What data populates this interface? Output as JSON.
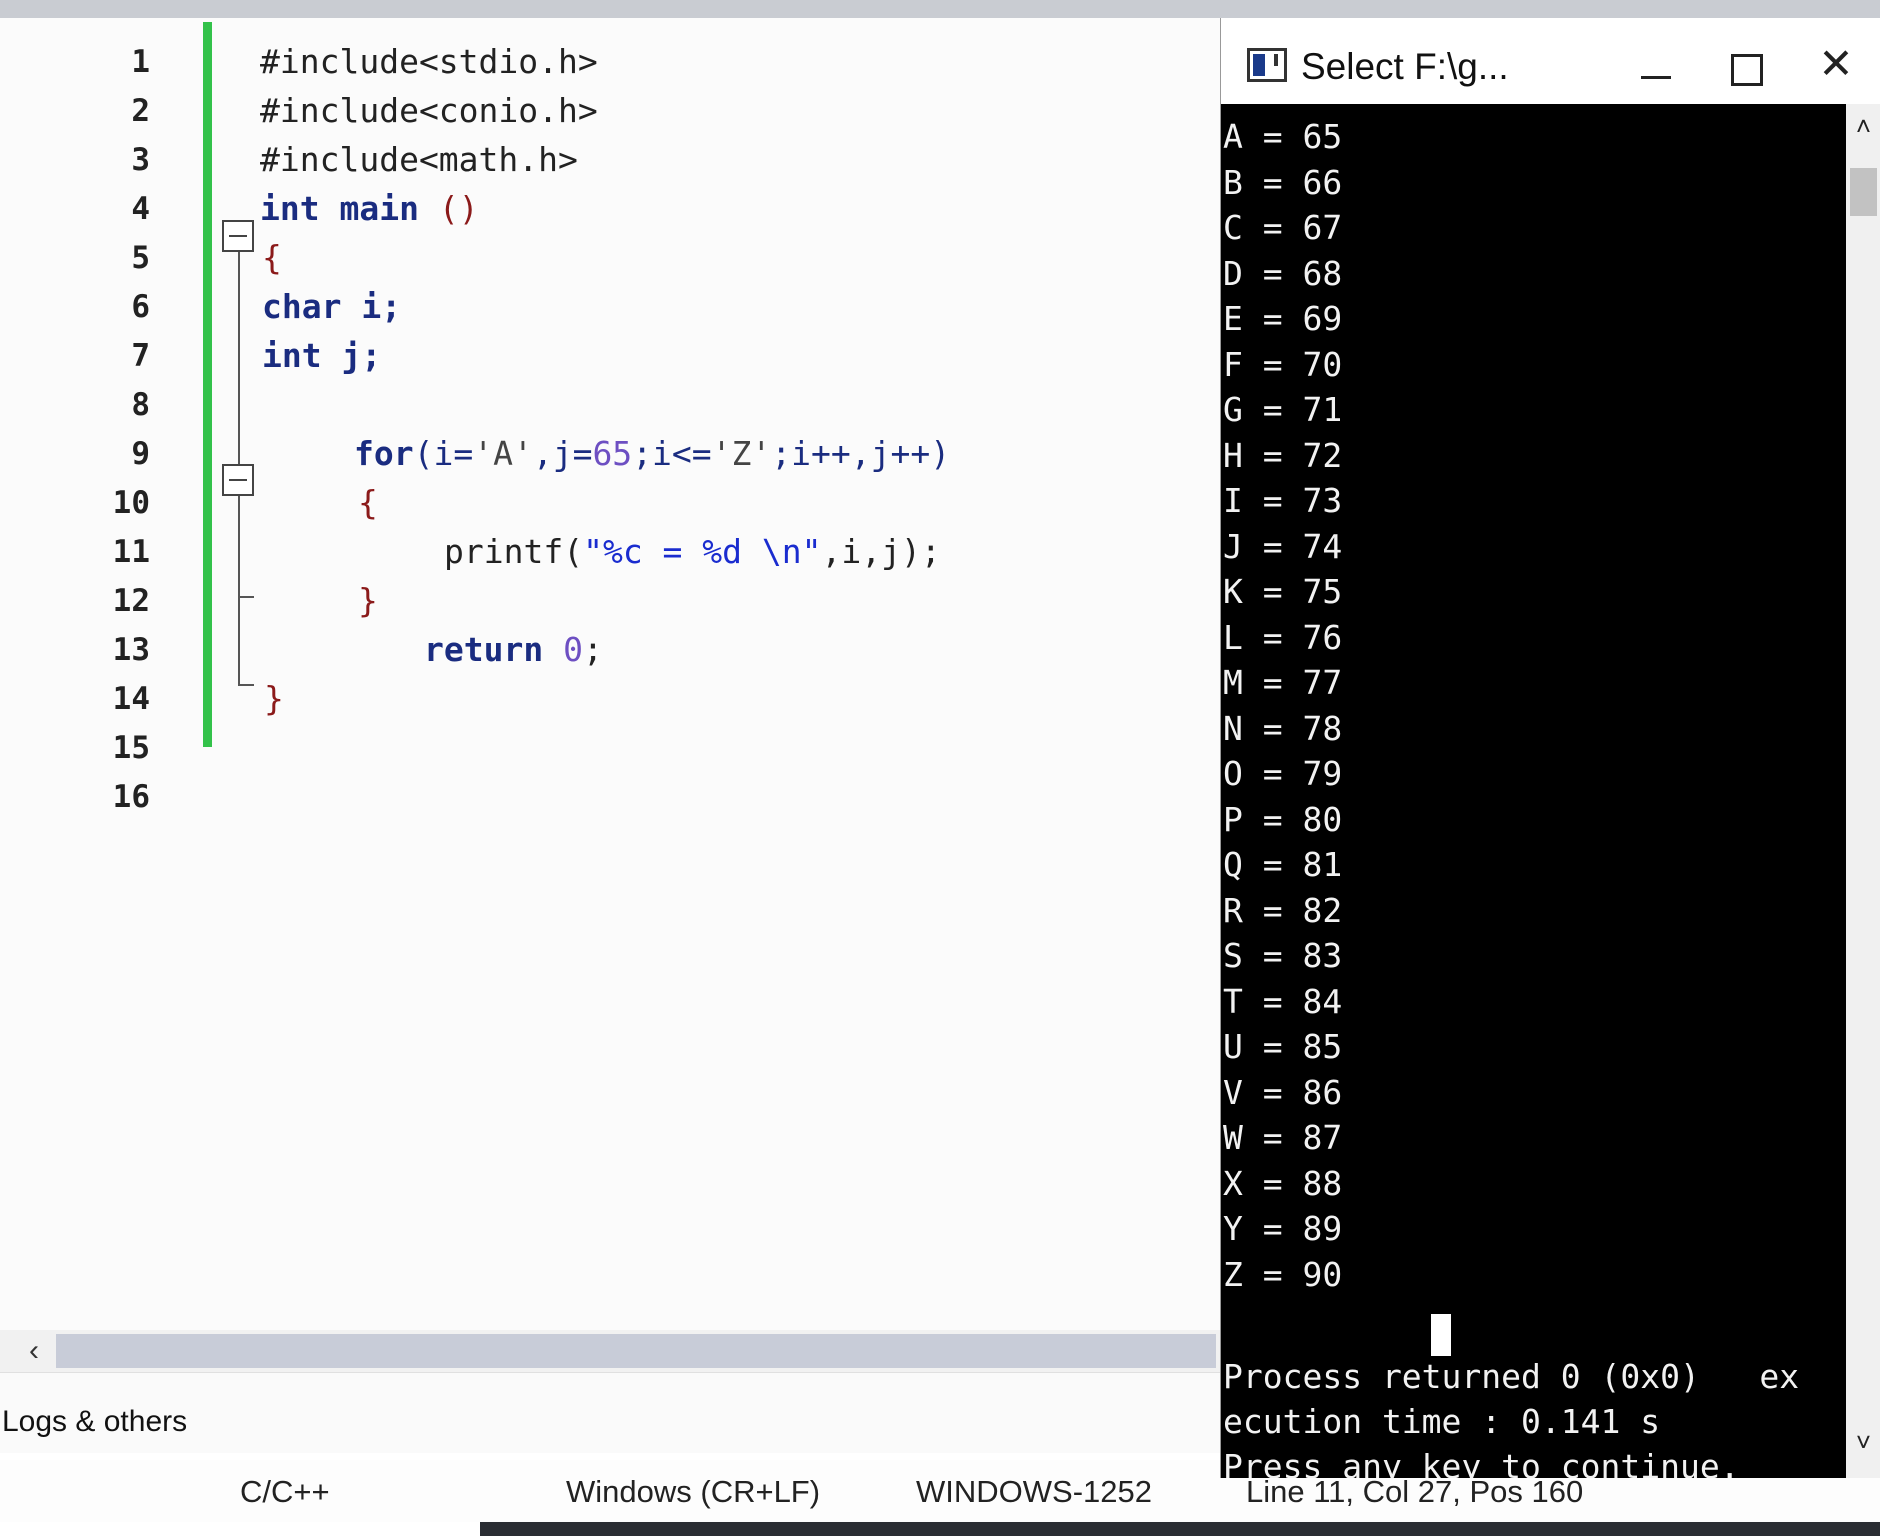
{
  "editor": {
    "line_numbers": [
      "1",
      "2",
      "3",
      "4",
      "5",
      "6",
      "7",
      "8",
      "9",
      "10",
      "11",
      "12",
      "13",
      "14",
      "15",
      "16"
    ],
    "code": {
      "l1": "#include<stdio.h>",
      "l2": "#include<conio.h>",
      "l3": "#include<math.h>",
      "l4_kw": "int",
      "l4_rest": " main ",
      "l4_paren": "()",
      "l5": "{",
      "l6_kw": "char",
      "l6_rest": " i;",
      "l7_kw": "int",
      "l7_rest": " j;",
      "l9_kw": "for",
      "l9_a": "(i=",
      "l9_chA": "'A'",
      "l9_b": ",j=",
      "l9_n65": "65",
      "l9_c": ";i<=",
      "l9_chZ": "'Z'",
      "l9_d": ";i++,j++)",
      "l10": "{",
      "l11_fn": "printf(",
      "l11_str": "\"%c = %d \\n\"",
      "l11_rest": ",i,j);",
      "l12": "}",
      "l13_kw": "return",
      "l13_num": "0",
      "l13_semi": ";",
      "l14": "}"
    }
  },
  "logs_panel": {
    "tab_label": "Logs & others"
  },
  "statusbar": {
    "language": "C/C++",
    "line_endings": "Windows (CR+LF)",
    "encoding": "WINDOWS-1252",
    "position": "Line 11, Col 27, Pos 160"
  },
  "console": {
    "title": "Select F:\\g...",
    "minimize_glyph": "",
    "maximize_glyph": "",
    "close_glyph": "✕",
    "output_lines": [
      "A = 65",
      "B = 66",
      "C = 67",
      "D = 68",
      "E = 69",
      "F = 70",
      "G = 71",
      "H = 72",
      "I = 73",
      "J = 74",
      "K = 75",
      "L = 76",
      "M = 77",
      "N = 78",
      "O = 79",
      "P = 80",
      "Q = 81",
      "R = 82",
      "S = 83",
      "T = 84",
      "U = 85",
      "V = 86",
      "W = 87",
      "X = 88",
      "Y = 89",
      "Z = 90"
    ],
    "footer_lines": [
      "Process returned 0 (0x0)   ex",
      "ecution time : 0.141 s",
      "Press any key to continue."
    ]
  },
  "icons": {
    "scroll_left": "‹",
    "scroll_up": "˄",
    "scroll_down": "˅"
  }
}
